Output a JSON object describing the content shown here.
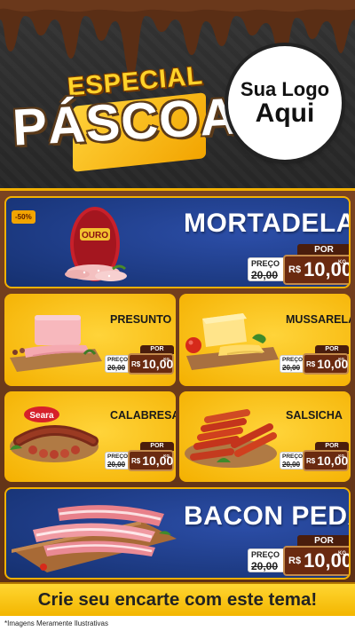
{
  "header": {
    "title_top": "ESPECIAL",
    "title_main": "PÁSCOA",
    "logo_line1": "Sua Logo",
    "logo_line2": "Aqui"
  },
  "products": [
    {
      "id": "mortadela",
      "name": "MORTADELA",
      "badge": "-50%",
      "brand": "OURO",
      "por": "POR",
      "old_label": "PREÇO",
      "old_prefix": "DE",
      "old_value": "20,00",
      "currency": "R$",
      "price": "10,00",
      "unit": "KG"
    },
    {
      "id": "presunto",
      "name": "PRESUNTO",
      "por": "POR",
      "old_label": "PREÇO",
      "old_prefix": "DE",
      "old_value": "20,00",
      "currency": "R$",
      "price": "10,00",
      "unit": "KG"
    },
    {
      "id": "mussarela",
      "name": "MUSSARELA",
      "por": "POR",
      "old_label": "PREÇO",
      "old_prefix": "DE",
      "old_value": "20,00",
      "currency": "R$",
      "price": "10,00",
      "unit": "KG"
    },
    {
      "id": "calabresa",
      "name": "CALABRESA",
      "brand": "Seara",
      "por": "POR",
      "old_label": "PREÇO",
      "old_prefix": "DE",
      "old_value": "20,00",
      "currency": "R$",
      "price": "10,00",
      "unit": "KG"
    },
    {
      "id": "salsicha",
      "name": "SALSICHA",
      "por": "POR",
      "old_label": "PREÇO",
      "old_prefix": "DE",
      "old_value": "20,00",
      "currency": "R$",
      "price": "10,00",
      "unit": "KG"
    },
    {
      "id": "bacon",
      "name": "BACON PEDAÇO",
      "por": "POR",
      "old_label": "PREÇO",
      "old_prefix": "DE",
      "old_value": "20,00",
      "currency": "R$",
      "price": "10,00",
      "unit": "KG"
    }
  ],
  "banner": "Crie seu encarte com este tema!",
  "footer": "*Imagens Meramente Ilustrativas",
  "colors": {
    "blue_card": "#1d3c8c",
    "yellow_card": "#f8c21a",
    "brown_panel": "#6b3818",
    "price_tag": "#6a2a10",
    "accent_gold": "#f2b000"
  }
}
